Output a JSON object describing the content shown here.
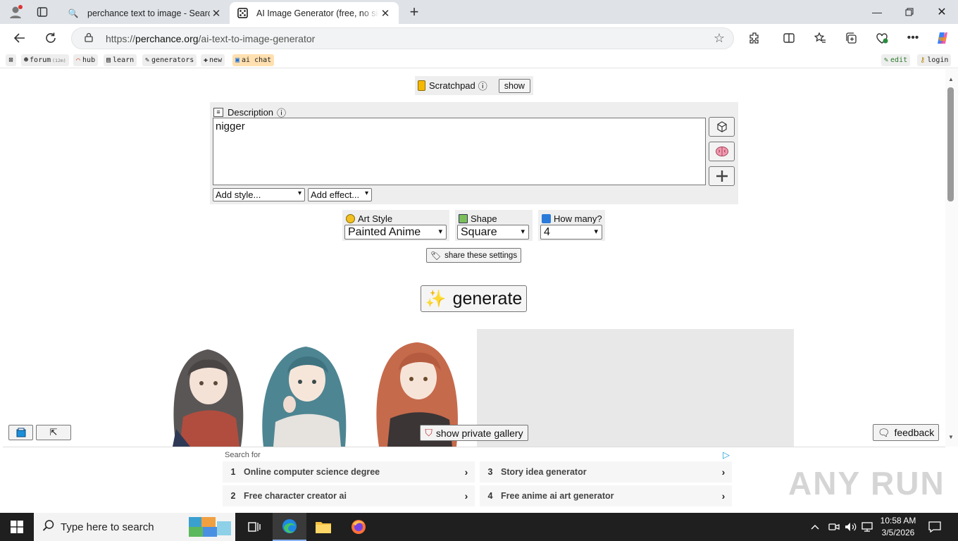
{
  "browser": {
    "tabs": [
      {
        "title": "perchance text to image - Search",
        "icon": "search-icon"
      },
      {
        "title": "AI Image Generator (free, no sign",
        "icon": "dice-icon"
      }
    ],
    "url_prefix": "https://",
    "url_host": "perchance.org",
    "url_path": "/ai-text-to-image-generator",
    "bookmarks": [
      {
        "label": "forum",
        "badge": "(12m)"
      },
      {
        "label": "hub"
      },
      {
        "label": "learn"
      },
      {
        "label": "generators"
      },
      {
        "label": "new"
      },
      {
        "label": "ai chat"
      }
    ],
    "bookmarks_right": [
      {
        "label": "edit"
      },
      {
        "label": "login"
      }
    ]
  },
  "page": {
    "scratchpad": {
      "label": "Scratchpad",
      "info": "ⓘ",
      "button": "show"
    },
    "description": {
      "label": "Description",
      "info": "ⓘ",
      "value": "nigger"
    },
    "add_style": "Add style...",
    "add_effect": "Add effect...",
    "art_style": {
      "label": "Art Style",
      "value": "Painted Anime"
    },
    "shape": {
      "label": "Shape",
      "value": "Square"
    },
    "how_many": {
      "label": "How many?",
      "value": "4"
    },
    "share_label": "share these settings",
    "generate_label": "generate",
    "private_gallery_label": "show private gallery",
    "feedback_label": "feedback"
  },
  "ads": {
    "heading": "Search for",
    "items": [
      {
        "num": "1",
        "text": "Online computer science degree"
      },
      {
        "num": "2",
        "text": "Free character creator ai"
      },
      {
        "num": "3",
        "text": "Story idea generator"
      },
      {
        "num": "4",
        "text": "Free anime ai art generator"
      }
    ]
  },
  "watermark": "ANY RUN",
  "taskbar": {
    "search_placeholder": "Type here to search",
    "time": "10:58 AM",
    "date": "3/5/2026"
  },
  "colors": {
    "accent": "#1a9fd9",
    "generate_spark": "#e8c000",
    "panel_bg": "#eeeeee"
  }
}
